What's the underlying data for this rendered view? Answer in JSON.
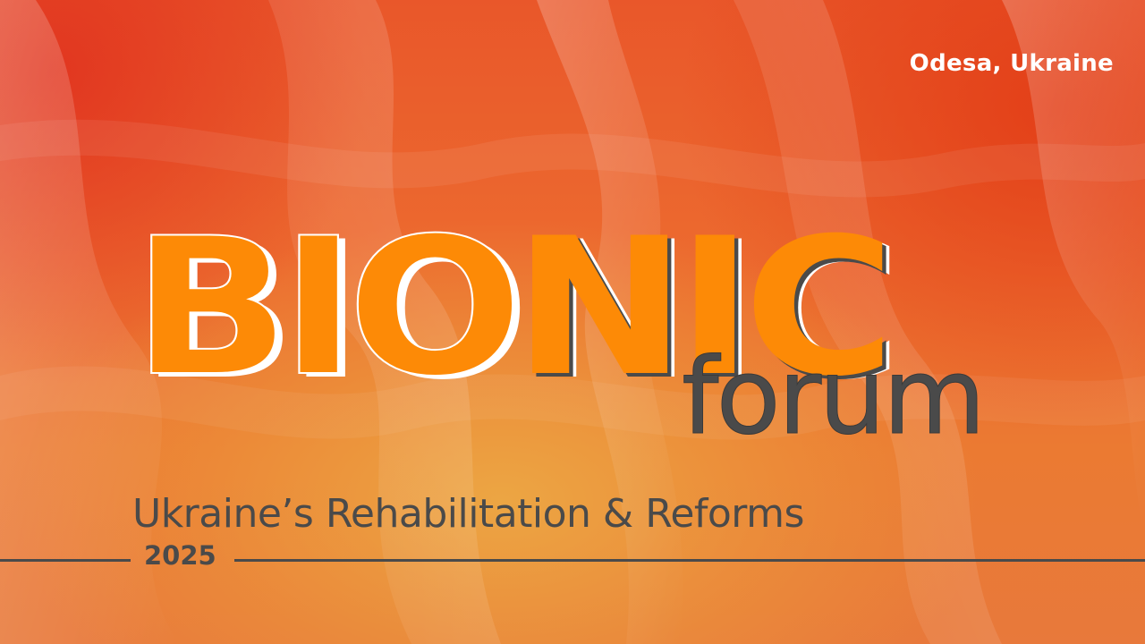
{
  "location": "Odesa, Ukraine",
  "title": {
    "main": "BIONIC",
    "main_head": "BIO",
    "main_tail": "NIC",
    "secondary": "forum"
  },
  "subtitle": "Ukraine’s Rehabilitation & Reforms",
  "year": "2025",
  "colors": {
    "title_orange": "#fd8a06",
    "text_dark": "#4a4a4a",
    "background_red": "#e9572a",
    "background_orange": "#eca844",
    "white": "#ffffff"
  }
}
